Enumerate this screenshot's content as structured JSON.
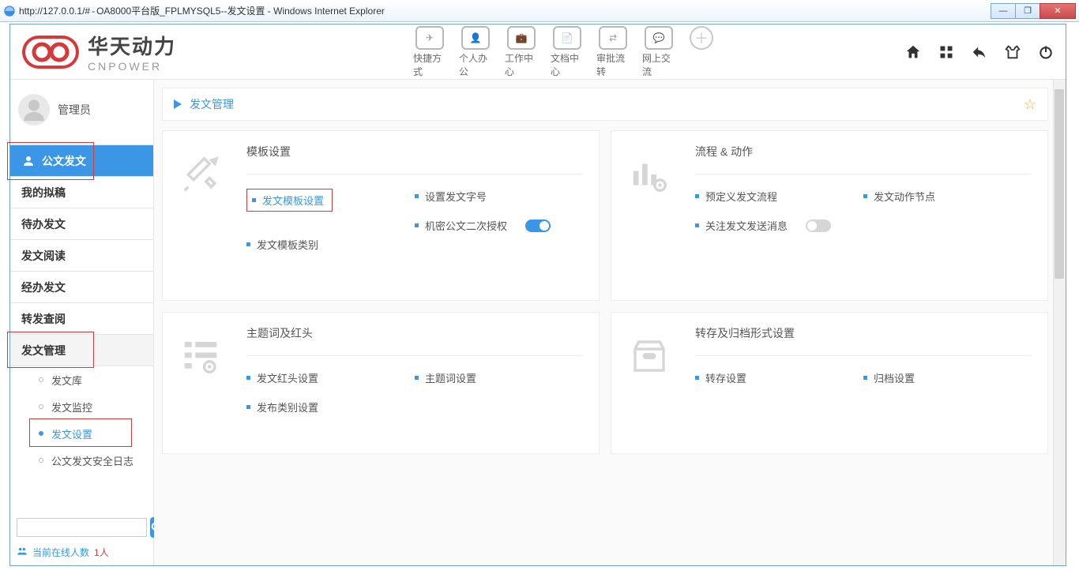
{
  "window": {
    "url": "http://127.0.0.1/#",
    "title": "OA8000平台版_FPLMYSQL5--发文设置 - Windows Internet Explorer"
  },
  "brand": {
    "cn": "华天动力",
    "en": "CNPOWER"
  },
  "topnav": {
    "items": [
      {
        "label": "快捷方式"
      },
      {
        "label": "个人办公"
      },
      {
        "label": "工作中心"
      },
      {
        "label": "文档中心"
      },
      {
        "label": "审批流转"
      },
      {
        "label": "网上交流"
      }
    ]
  },
  "user": {
    "name": "管理员"
  },
  "sidebar": {
    "active": "公文发文",
    "items": [
      {
        "label": "我的拟稿"
      },
      {
        "label": "待办发文"
      },
      {
        "label": "发文阅读"
      },
      {
        "label": "经办发文"
      },
      {
        "label": "转发查阅"
      }
    ],
    "selected": "发文管理",
    "subitems": [
      {
        "label": "发文库"
      },
      {
        "label": "发文监控"
      },
      {
        "label": "发文设置"
      },
      {
        "label": "公文发文安全日志"
      }
    ]
  },
  "footer": {
    "online_label": "当前在线人数",
    "online_count": "1人"
  },
  "crumb": {
    "title": "发文管理"
  },
  "cards": {
    "template": {
      "title": "模板设置",
      "left": [
        {
          "label": "发文模板设置",
          "boxed": true
        },
        {
          "label": "发文模板类别"
        }
      ],
      "right": [
        {
          "label": "设置发文字号"
        },
        {
          "label": "机密公文二次授权",
          "toggle": "on"
        }
      ]
    },
    "process": {
      "title": "流程 & 动作",
      "left": [
        {
          "label": "预定义发文流程"
        },
        {
          "label": "关注发文发送消息",
          "toggle": "off"
        }
      ],
      "right": [
        {
          "label": "发文动作节点"
        }
      ]
    },
    "subject": {
      "title": "主题词及红头",
      "left": [
        {
          "label": "发文红头设置"
        },
        {
          "label": "发布类别设置"
        }
      ],
      "right": [
        {
          "label": "主题词设置"
        }
      ]
    },
    "archive": {
      "title": "转存及归档形式设置",
      "left": [
        {
          "label": "转存设置"
        }
      ],
      "right": [
        {
          "label": "归档设置"
        }
      ]
    }
  }
}
